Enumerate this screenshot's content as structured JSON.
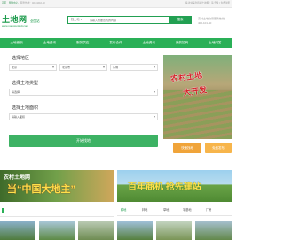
{
  "topbar": {
    "links": [
      "首页",
      "帮助中心"
    ],
    "service_text": "服务热线：400-1010-50",
    "right_text": "嗨,欢迎来到农村土地网！请 登录 | 免费注册"
  },
  "header": {
    "logo_text": "土地网",
    "logo_url": "www.nongcuntudi.com",
    "city": "全国站",
    "search": {
      "type_label": "找土地 ▾",
      "placeholder": "请输入想要查找的内容",
      "button_label": "搜索"
    },
    "hotline_label": "农村土地交易服务热线",
    "hotline_number": "400-101-50"
  },
  "nav": {
    "items": [
      "土地首页",
      "土地资讯",
      "服务供应",
      "发布合作",
      "土地资讯",
      "我的招商",
      "土地问答"
    ]
  },
  "filter": {
    "location": {
      "title": "选择地区",
      "selects": [
        "北京",
        "北京市",
        "东城"
      ]
    },
    "land_type": {
      "title": "选择土地类型",
      "select": "请选择"
    },
    "area": {
      "title": "选择土地面积",
      "select": "请输入面积"
    },
    "start_button": "开始找地"
  },
  "banner": {
    "text_lines": [
      "农村土地",
      "大开发"
    ]
  },
  "right_buttons": [
    "快速找地",
    "免费发布"
  ],
  "promo_left": {
    "line1": "农村土地网",
    "line2": "当“中国大地主”"
  },
  "promo_right": {
    "text": "百年商机  抢先建站"
  },
  "tabs": [
    "耕地",
    "林地",
    "草地",
    "宅基地",
    "厂房"
  ],
  "colors": {
    "brand_green": "#2ab057",
    "accent_orange": "#f0a43a",
    "banner_red": "#d4222a"
  }
}
